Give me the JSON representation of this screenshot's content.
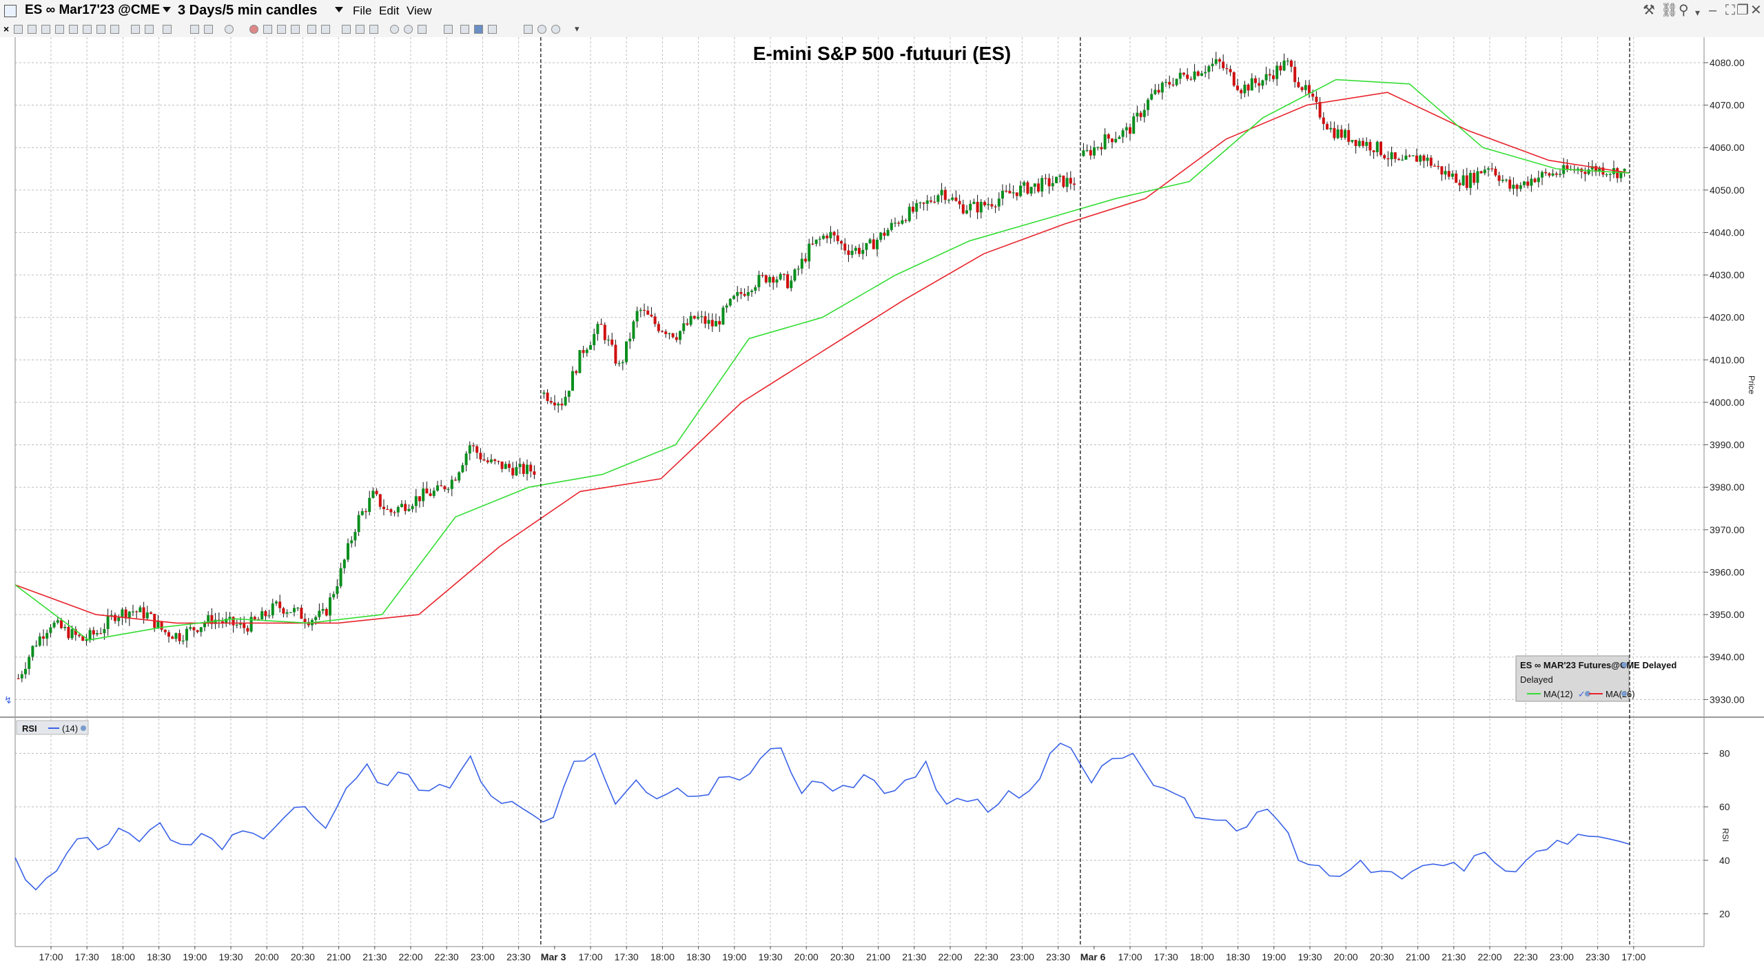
{
  "window": {
    "symbol": "ES ∞ Mar17'23 @CME",
    "period": "3 Days/5 min candles",
    "menus": [
      "File",
      "Edit",
      "View"
    ]
  },
  "colors": {
    "up_candle": "#0a8f1e",
    "down_candle": "#d01010",
    "ma12": "#33dd33",
    "ma26": "#e8222a",
    "rsi": "#3a62e8",
    "grid": "#bdbdbd"
  },
  "chart_data": [
    {
      "type": "candlestick",
      "title": "E-mini S&P 500 -futuuri (ES)",
      "ylabel": "Price",
      "ylim": [
        3926,
        4086
      ],
      "y_ticks": [
        "4080.00",
        "4070.00",
        "4060.00",
        "4050.00",
        "4040.00",
        "4030.00",
        "4020.00",
        "4010.00",
        "4000.00",
        "3990.00",
        "3980.00",
        "3970.00",
        "3960.00",
        "3950.00",
        "3940.00",
        "3930.00"
      ],
      "x_ticks": [
        "17:00",
        "17:30",
        "18:00",
        "18:30",
        "19:00",
        "19:30",
        "20:00",
        "20:30",
        "21:00",
        "21:30",
        "22:00",
        "22:30",
        "23:00",
        "23:30",
        "Mar 3",
        "17:00",
        "17:30",
        "18:00",
        "18:30",
        "19:00",
        "19:30",
        "20:00",
        "20:30",
        "21:00",
        "21:30",
        "22:00",
        "22:30",
        "23:00",
        "23:30",
        "Mar 6",
        "17:00",
        "17:30",
        "18:00",
        "18:30",
        "19:00",
        "19:30",
        "20:00",
        "20:30",
        "21:00",
        "21:30",
        "22:00",
        "22:30",
        "23:00",
        "23:30",
        "17:00"
      ],
      "session_dividers": [
        "Mar 3",
        "Mar 6"
      ],
      "grid": true,
      "legend_placement": "bottom-right",
      "legend": {
        "title": "ES ∞ MAR'23 Futures@CME Delayed",
        "subtitle": "Delayed",
        "items": [
          "MA(12)",
          "MA(26)"
        ]
      },
      "series_anchors": [
        {
          "name": "session 1",
          "close": [
            3935,
            3943,
            3948,
            3946,
            3944,
            3946,
            3950,
            3951,
            3950,
            3946,
            3945,
            3947,
            3949,
            3948,
            3947,
            3949,
            3952,
            3951,
            3949,
            3950,
            3960,
            3972,
            3978,
            3974,
            3976,
            3978,
            3979,
            3982,
            3990,
            3986,
            3985,
            3984,
            3984
          ]
        },
        {
          "name": "session 2",
          "close": [
            4002,
            4000,
            4012,
            4018,
            4008,
            4022,
            4018,
            4016,
            4020,
            4018,
            4024,
            4028,
            4030,
            4028,
            4036,
            4040,
            4036,
            4036,
            4040,
            4044,
            4046,
            4050,
            4046,
            4046,
            4048,
            4050,
            4051,
            4052,
            4052
          ]
        },
        {
          "name": "session 3",
          "close": [
            4058,
            4062,
            4064,
            4072,
            4076,
            4078,
            4080,
            4074,
            4076,
            4080,
            4072,
            4064,
            4062,
            4060,
            4056,
            4058,
            4054,
            4052,
            4056,
            4050,
            4053,
            4054,
            4055,
            4055,
            4054
          ]
        },
        {
          "name": "MA(12)",
          "value": [
            3957,
            3944,
            3947,
            3949,
            3948,
            3950,
            3973,
            3980,
            3983,
            3990,
            4015,
            4020,
            4030,
            4038,
            4043,
            4048,
            4052,
            4067,
            4076,
            4075,
            4060,
            4055,
            4054
          ]
        },
        {
          "name": "MA(26)",
          "value": [
            3957,
            3950,
            3948,
            3948,
            3948,
            3950,
            3966,
            3979,
            3982,
            4000,
            4012,
            4024,
            4035,
            4042,
            4048,
            4062,
            4070,
            4073,
            4064,
            4057,
            4054
          ]
        }
      ]
    },
    {
      "type": "line",
      "title": "RSI",
      "series_label": "(14)",
      "ylabel": "RSI",
      "ylim": [
        8,
        93
      ],
      "y_ticks": [
        "80",
        "60",
        "40",
        "20"
      ],
      "rsi_anchors": [
        41,
        29,
        36,
        48,
        44,
        52,
        47,
        54,
        46,
        50,
        44,
        51,
        48,
        56,
        60,
        52,
        67,
        76,
        68,
        72,
        66,
        67,
        79,
        64,
        62,
        57,
        56,
        77,
        80,
        61,
        70,
        63,
        67,
        64,
        71,
        70,
        78,
        82,
        65,
        69,
        68,
        72,
        65,
        70,
        77,
        61,
        62,
        58,
        66,
        66,
        80,
        82,
        69,
        78,
        80,
        68,
        65,
        56,
        55,
        51,
        58,
        55,
        40,
        38,
        34,
        40,
        36,
        33,
        38,
        38,
        36,
        43,
        36,
        40,
        44,
        46,
        49,
        48,
        46
      ]
    }
  ]
}
